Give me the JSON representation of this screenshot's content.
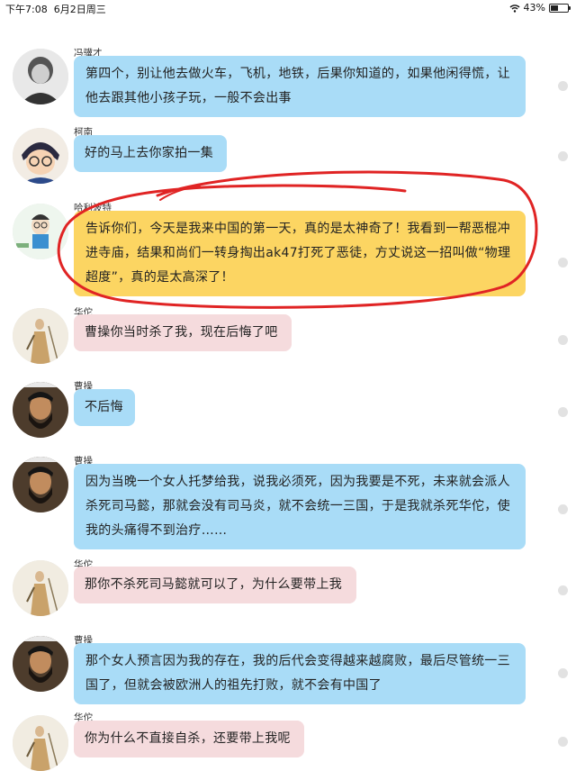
{
  "status": {
    "time": "下午7:08",
    "date": "6月2日周三",
    "battery": "43%",
    "battery_level": 0.43
  },
  "messages": [
    {
      "sender": "冯骥才",
      "text": "第四个，别让他去做火车，飞机，地铁，后果你知道的，如果他闲得慌，让他去跟其他小孩子玩，一般不会出事",
      "color": "#a9dcf7",
      "avatar": "portrait-old-man"
    },
    {
      "sender": "柯南",
      "text": "好的马上去你家拍一集",
      "color": "#a9dcf7",
      "avatar": "cartoon-detective"
    },
    {
      "sender": "哈利波特",
      "text": "告诉你们，今天是我来中国的第一天，真的是太神奇了！我看到一帮恶棍冲进寺庙，结果和尚们一转身掏出ak47打死了恶徒，方丈说这一招叫做“物理超度”，真的是太高深了！",
      "color": "#fcd562",
      "avatar": "cartoon-boy-glasses"
    },
    {
      "sender": "华佗",
      "text": "曹操你当时杀了我，现在后悔了吧",
      "color": "#f5dbdd",
      "avatar": "painting-sage"
    },
    {
      "sender": "曹操",
      "text": "不后悔",
      "color": "#a9dcf7",
      "avatar": "bearded-man"
    },
    {
      "sender": "曹操",
      "text": "因为当晚一个女人托梦给我，说我必须死，因为我要是不死，未来就会派人杀死司马懿，那就会没有司马炎，就不会统一三国，于是我就杀死华佗，使我的头痛得不到治疗……",
      "color": "#a9dcf7",
      "avatar": "bearded-man"
    },
    {
      "sender": "华佗",
      "text": "那你不杀死司马懿就可以了，为什么要带上我",
      "color": "#f5dbdd",
      "avatar": "painting-sage"
    },
    {
      "sender": "曹操",
      "text": "那个女人预言因为我的存在，我的后代会变得越来越腐败，最后尽管统一三国了，但就会被欧洲人的祖先打败，就不会有中国了",
      "color": "#a9dcf7",
      "avatar": "bearded-man"
    },
    {
      "sender": "华佗",
      "text": "你为什么不直接自杀，还要带上我呢",
      "color": "#f5dbdd",
      "avatar": "painting-sage"
    }
  ]
}
